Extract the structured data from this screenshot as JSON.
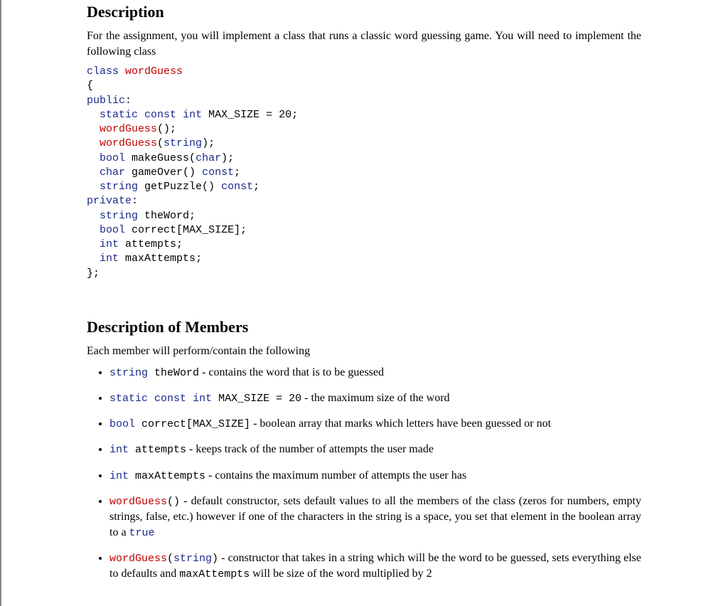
{
  "section1": {
    "heading": "Description",
    "intro": "For the assignment, you will implement a class that runs a classic word guessing game. You will need to implement the following class"
  },
  "code": {
    "l01a": "class",
    "l01b": "wordGuess",
    "l02": "{",
    "l03": "public",
    "l04a": "static",
    "l04b": "const",
    "l04c": "int",
    "l04d": "MAX_SIZE = 20;",
    "l05": "wordGuess",
    "l05b": "();",
    "l06a": "wordGuess",
    "l06b": "string",
    "l07a": "bool",
    "l07b": "makeGuess(",
    "l07c": "char",
    "l07d": ");",
    "l08a": "char",
    "l08b": "gameOver()",
    "l08c": "const",
    "l09a": "string",
    "l09b": "getPuzzle()",
    "l09c": "const",
    "l10": "private",
    "l11a": "string",
    "l11b": "theWord;",
    "l12a": "bool",
    "l12b": "correct[MAX_SIZE];",
    "l13a": "int",
    "l13b": "attempts;",
    "l14a": "int",
    "l14b": "maxAttempts;",
    "l15": "};"
  },
  "section2": {
    "heading": "Description of Members",
    "intro": "Each member will perform/contain the following"
  },
  "members": {
    "m1": {
      "c1": "string",
      "c2": "theWord",
      "desc": " - contains the word that is to be guessed"
    },
    "m2": {
      "c1": "static",
      "c2": "const",
      "c3": "int",
      "c4": "MAX_SIZE = 20",
      "desc": " - the maximum size of the word"
    },
    "m3": {
      "c1": "bool",
      "c2": "correct[MAX_SIZE]",
      "desc": " - boolean array that marks which letters have been guessed or not"
    },
    "m4": {
      "c1": "int",
      "c2": "attempts",
      "desc": " - keeps track of the number of attempts the user made"
    },
    "m5": {
      "c1": "int",
      "c2": "maxAttempts",
      "desc": " - contains the maximum number of attempts the user has"
    },
    "m6": {
      "c1": "wordGuess",
      "c2": "()",
      "desc_a": " - default constructor, sets default values to all the members of the class (zeros for numbers, empty strings, false, etc.) however if one of the characters in the string is a space, you set that element in the boolean array to a ",
      "c3": "true"
    },
    "m7": {
      "c1": "wordGuess",
      "c2": "(",
      "c3": "string",
      "c4": ")",
      "desc_a": " - constructor that takes in a string which will be the word to be guessed, sets everything else to defaults and ",
      "c5": "maxAttempts",
      "desc_b": " will be size of the word multiplied by 2"
    }
  }
}
